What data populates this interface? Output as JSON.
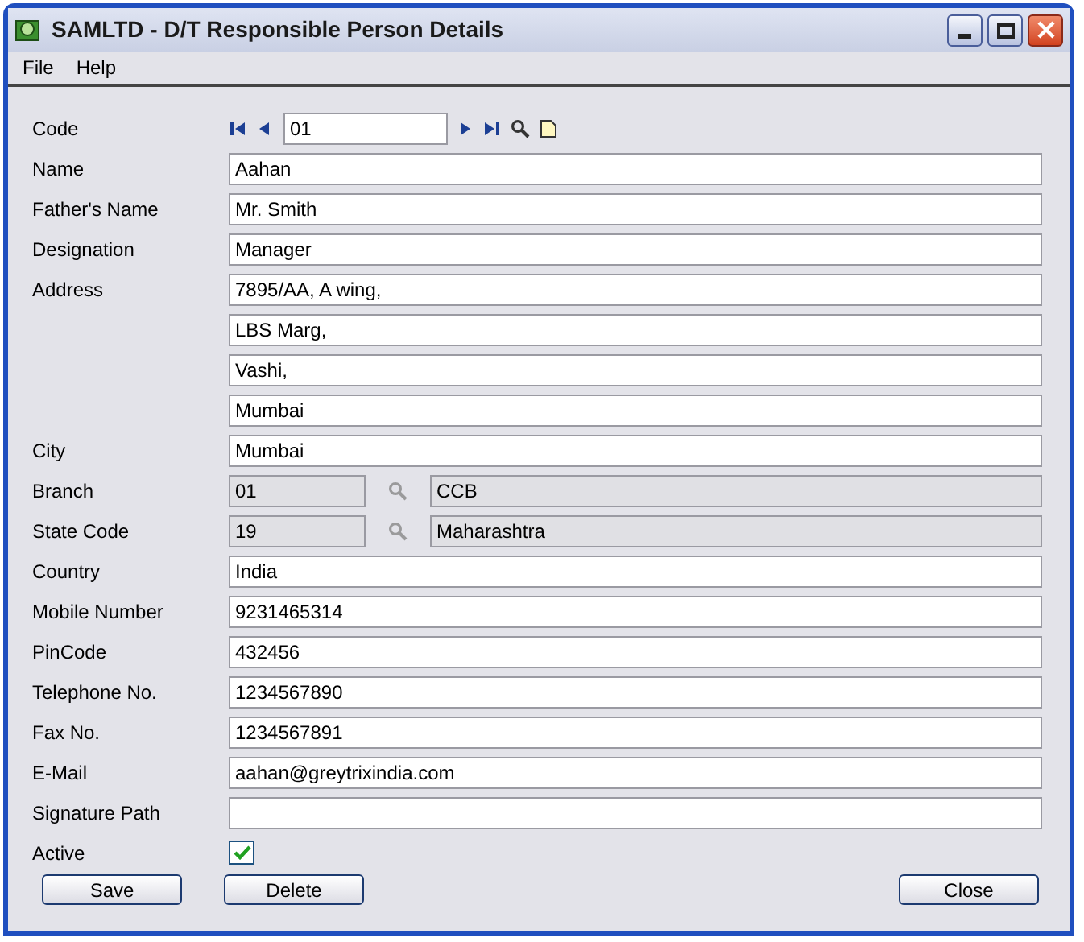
{
  "window": {
    "title": "SAMLTD - D/T Responsible Person Details"
  },
  "menu": [
    "File",
    "Help"
  ],
  "code": {
    "label": "Code",
    "value": "01"
  },
  "fields": [
    {
      "kind": "text",
      "label": "Name",
      "value": "Aahan"
    },
    {
      "kind": "text",
      "label": "Father's Name",
      "value": "Mr. Smith"
    },
    {
      "kind": "text",
      "label": "Designation",
      "value": "Manager"
    },
    {
      "kind": "text",
      "label": "Address",
      "value": "7895/AA, A wing,"
    },
    {
      "kind": "text",
      "value": "LBS Marg,"
    },
    {
      "kind": "text",
      "value": "Vashi,"
    },
    {
      "kind": "text",
      "value": "Mumbai"
    },
    {
      "kind": "text",
      "label": "City",
      "value": "Mumbai"
    },
    {
      "kind": "lookup",
      "label": "Branch",
      "value": "01",
      "description": "CCB"
    },
    {
      "kind": "lookup",
      "label": "State Code",
      "value": "19",
      "description": "Maharashtra"
    },
    {
      "kind": "text",
      "label": "Country",
      "value": "India"
    },
    {
      "kind": "text",
      "label": "Mobile Number",
      "value": "9231465314"
    },
    {
      "kind": "text",
      "label": "PinCode",
      "value": "432456"
    },
    {
      "kind": "text",
      "label": "Telephone No.",
      "value": "1234567890"
    },
    {
      "kind": "text",
      "label": "Fax No.",
      "value": "1234567891"
    },
    {
      "kind": "text",
      "label": "E-Mail",
      "value": "aahan@greytrixindia.com"
    },
    {
      "kind": "text",
      "label": "Signature Path"
    },
    {
      "kind": "checkbox",
      "label": "Active",
      "checked": true
    }
  ],
  "buttons": {
    "left": [
      "Save",
      "Delete"
    ],
    "right": [
      "Close"
    ]
  }
}
